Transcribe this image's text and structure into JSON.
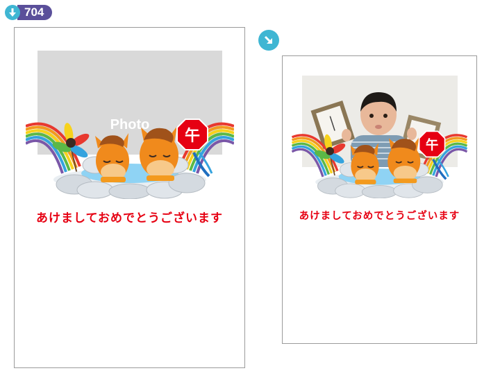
{
  "header": {
    "template_number": "704"
  },
  "template_card": {
    "photo_label": "Photo",
    "greeting": "あけましておめでとうございます",
    "sign_char": "午"
  },
  "sample_card": {
    "greeting": "あけましておめでとうございます",
    "sign_char": "午"
  },
  "icons": {
    "download": "download-icon",
    "arrow": "arrow-down-right-icon"
  },
  "colors": {
    "accent_blue": "#3fb6d3",
    "badge_purple": "#5a4f9a",
    "greeting_red": "#e60012",
    "horse_orange": "#f08a1c"
  }
}
